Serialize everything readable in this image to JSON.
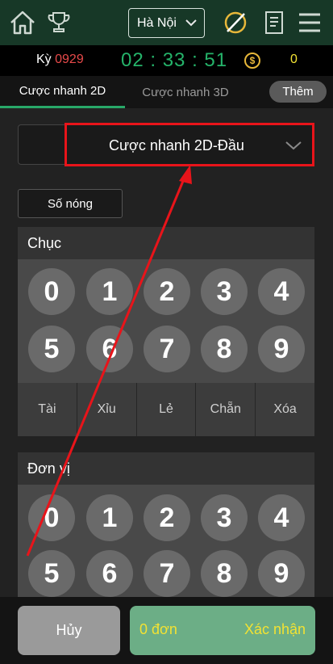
{
  "header": {
    "region_select": {
      "value": "Hà Nội"
    }
  },
  "timer": {
    "ky_label": "Kỳ",
    "ky_number": "0929",
    "countdown": "02 : 33 : 51",
    "coin_symbol": "$",
    "balance": "0"
  },
  "tabs": [
    {
      "label": "Cược nhanh 2D",
      "active": true
    },
    {
      "label": "Cược nhanh 3D",
      "active": false
    }
  ],
  "more_tab": "Thêm",
  "bet_type_select": {
    "value": "Cược nhanh 2D-Đầu"
  },
  "hot_numbers_label": "Số nóng",
  "panels": [
    {
      "title": "Chục",
      "digits": [
        "0",
        "1",
        "2",
        "3",
        "4",
        "5",
        "6",
        "7",
        "8",
        "9"
      ],
      "actions": [
        "Tài",
        "Xỉu",
        "Lẻ",
        "Chẵn",
        "Xóa"
      ]
    },
    {
      "title": "Đơn vị",
      "digits": [
        "0",
        "1",
        "2",
        "3",
        "4",
        "5",
        "6",
        "7",
        "8",
        "9"
      ]
    }
  ],
  "footer": {
    "cancel_label": "Hủy",
    "order_count": "0 đơn",
    "confirm_label": "Xác nhận"
  },
  "colors": {
    "accent_green": "#28a868",
    "countdown_green": "#25b36a",
    "highlight_red": "#e8141a",
    "balance_yellow": "#f2e233"
  },
  "icons": [
    "home-icon",
    "trophy-icon",
    "chevron-down-icon",
    "no-sound-icon",
    "document-icon",
    "menu-icon",
    "coin-icon"
  ]
}
